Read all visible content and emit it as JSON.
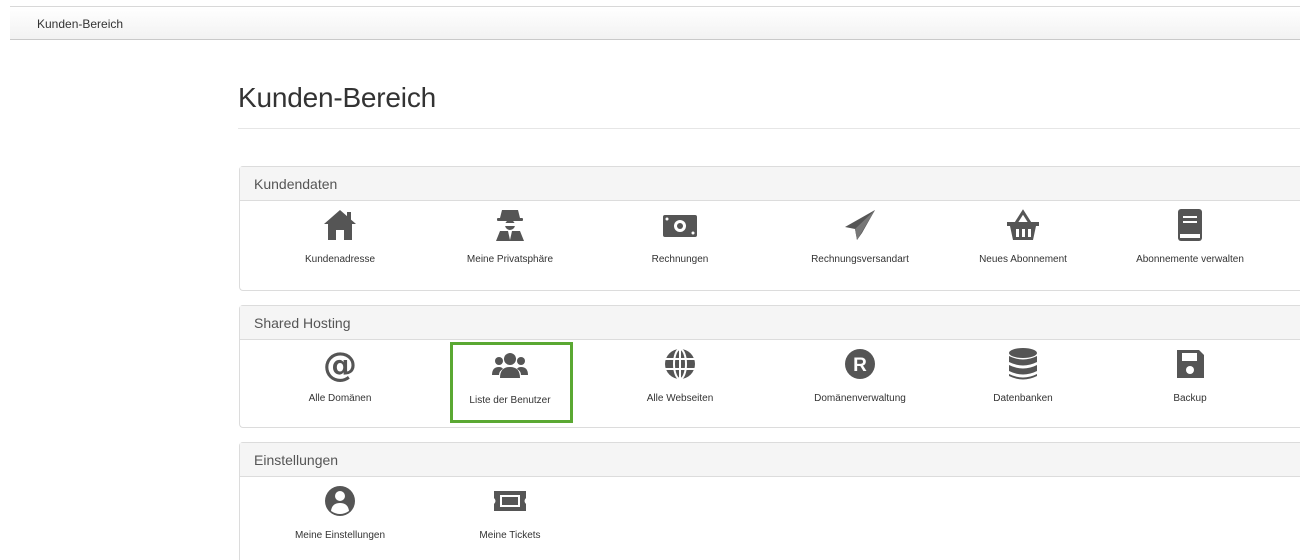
{
  "topbar": {
    "link_label": "Kunden-Bereich"
  },
  "page": {
    "title": "Kunden-Bereich"
  },
  "panels": [
    {
      "heading": "Kundendaten",
      "items": [
        {
          "label": "Kundenadresse",
          "icon": "home-icon"
        },
        {
          "label": "Meine Privatsphäre",
          "icon": "user-secret-icon"
        },
        {
          "label": "Rechnungen",
          "icon": "money-bill-icon"
        },
        {
          "label": "Rechnungsversandart",
          "icon": "paper-plane-icon"
        },
        {
          "label": "Neues Abonnement",
          "icon": "shopping-basket-icon"
        },
        {
          "label": "Abonnemente verwalten",
          "icon": "book-icon"
        }
      ]
    },
    {
      "heading": "Shared Hosting",
      "items": [
        {
          "label": "Alle Domänen",
          "icon": "at-icon"
        },
        {
          "label": "Liste der Benutzer",
          "icon": "users-icon",
          "selected": true
        },
        {
          "label": "Alle Webseiten",
          "icon": "globe-icon"
        },
        {
          "label": "Domänenverwaltung",
          "icon": "registered-icon"
        },
        {
          "label": "Datenbanken",
          "icon": "database-icon"
        },
        {
          "label": "Backup",
          "icon": "save-icon"
        }
      ]
    },
    {
      "heading": "Einstellungen",
      "items": [
        {
          "label": "Meine Einstellungen",
          "icon": "user-circle-icon"
        },
        {
          "label": "Meine Tickets",
          "icon": "ticket-icon"
        }
      ]
    }
  ],
  "colors": {
    "icon": "#555555",
    "selected_border": "#5aa832",
    "heading_bg": "#f5f5f5"
  }
}
